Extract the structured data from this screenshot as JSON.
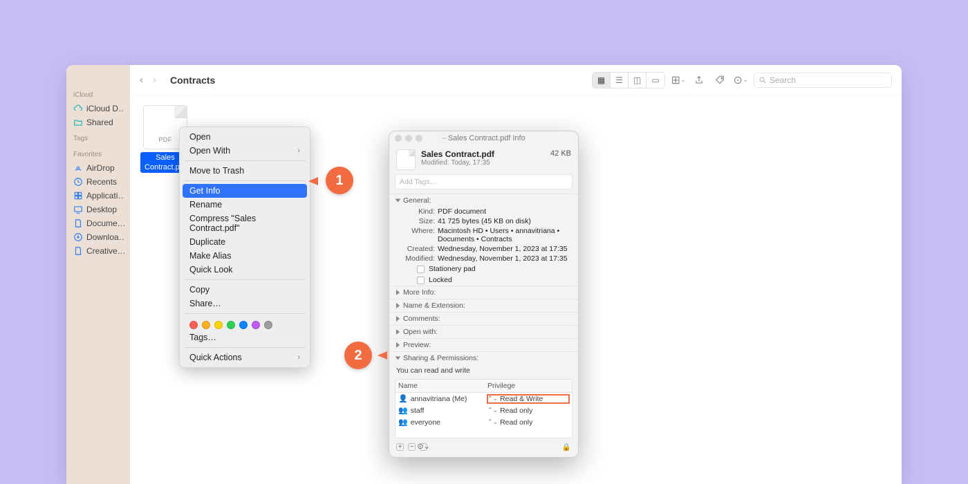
{
  "sidebar": {
    "icloud_label": "iCloud",
    "icloud_items": [
      "iCloud D…",
      "Shared"
    ],
    "tags_label": "Tags",
    "favorites_label": "Favorites",
    "fav_items": [
      "AirDrop",
      "Recents",
      "Applicati…",
      "Desktop",
      "Docume…",
      "Downloa…",
      "Creative…"
    ]
  },
  "toolbar": {
    "location": "Contracts",
    "search_placeholder": "Search"
  },
  "file": {
    "ext_badge": "PDF",
    "name_line1": "Sales",
    "name_line2": "Contract.pdf"
  },
  "context_menu": {
    "open": "Open",
    "open_with": "Open With",
    "move_to_trash": "Move to Trash",
    "get_info": "Get Info",
    "rename": "Rename",
    "compress": "Compress \"Sales Contract.pdf\"",
    "duplicate": "Duplicate",
    "make_alias": "Make Alias",
    "quick_look": "Quick Look",
    "copy": "Copy",
    "share": "Share…",
    "tags_label": "Tags…",
    "quick_actions": "Quick Actions",
    "tag_colors": [
      "#ff5f57",
      "#ffb01f",
      "#ffd60a",
      "#30d158",
      "#0a84ff",
      "#bf5af2",
      "#9e9e9e"
    ]
  },
  "callouts": {
    "one": "1",
    "two": "2"
  },
  "info": {
    "titlebar": "Sales Contract.pdf Info",
    "name": "Sales Contract.pdf",
    "modified_label": "Modified:",
    "modified_short": "Today, 17:35",
    "size_short": "42 KB",
    "add_tags": "Add Tags…",
    "general_label": "General:",
    "kind_k": "Kind:",
    "kind_v": "PDF document",
    "size_k": "Size:",
    "size_v": "41 725 bytes (45 KB on disk)",
    "where_k": "Where:",
    "where_v": "Macintosh HD • Users • annavitriana • Documents • Contracts",
    "created_k": "Created:",
    "created_v": "Wednesday, November 1, 2023 at 17:35",
    "modified_k": "Modified:",
    "modified_v": "Wednesday, November 1, 2023 at 17:35",
    "stationery": "Stationery pad",
    "locked": "Locked",
    "more_info": "More Info:",
    "name_ext": "Name & Extension:",
    "comments": "Comments:",
    "open_with": "Open with:",
    "preview": "Preview:",
    "sharing": "Sharing & Permissions:",
    "sharing_note": "You can read and write",
    "col_name": "Name",
    "col_priv": "Privilege",
    "rows": [
      {
        "name": "annavitriana (Me)",
        "priv": "Read & Write"
      },
      {
        "name": "staff",
        "priv": "Read only"
      },
      {
        "name": "everyone",
        "priv": "Read only"
      }
    ]
  }
}
